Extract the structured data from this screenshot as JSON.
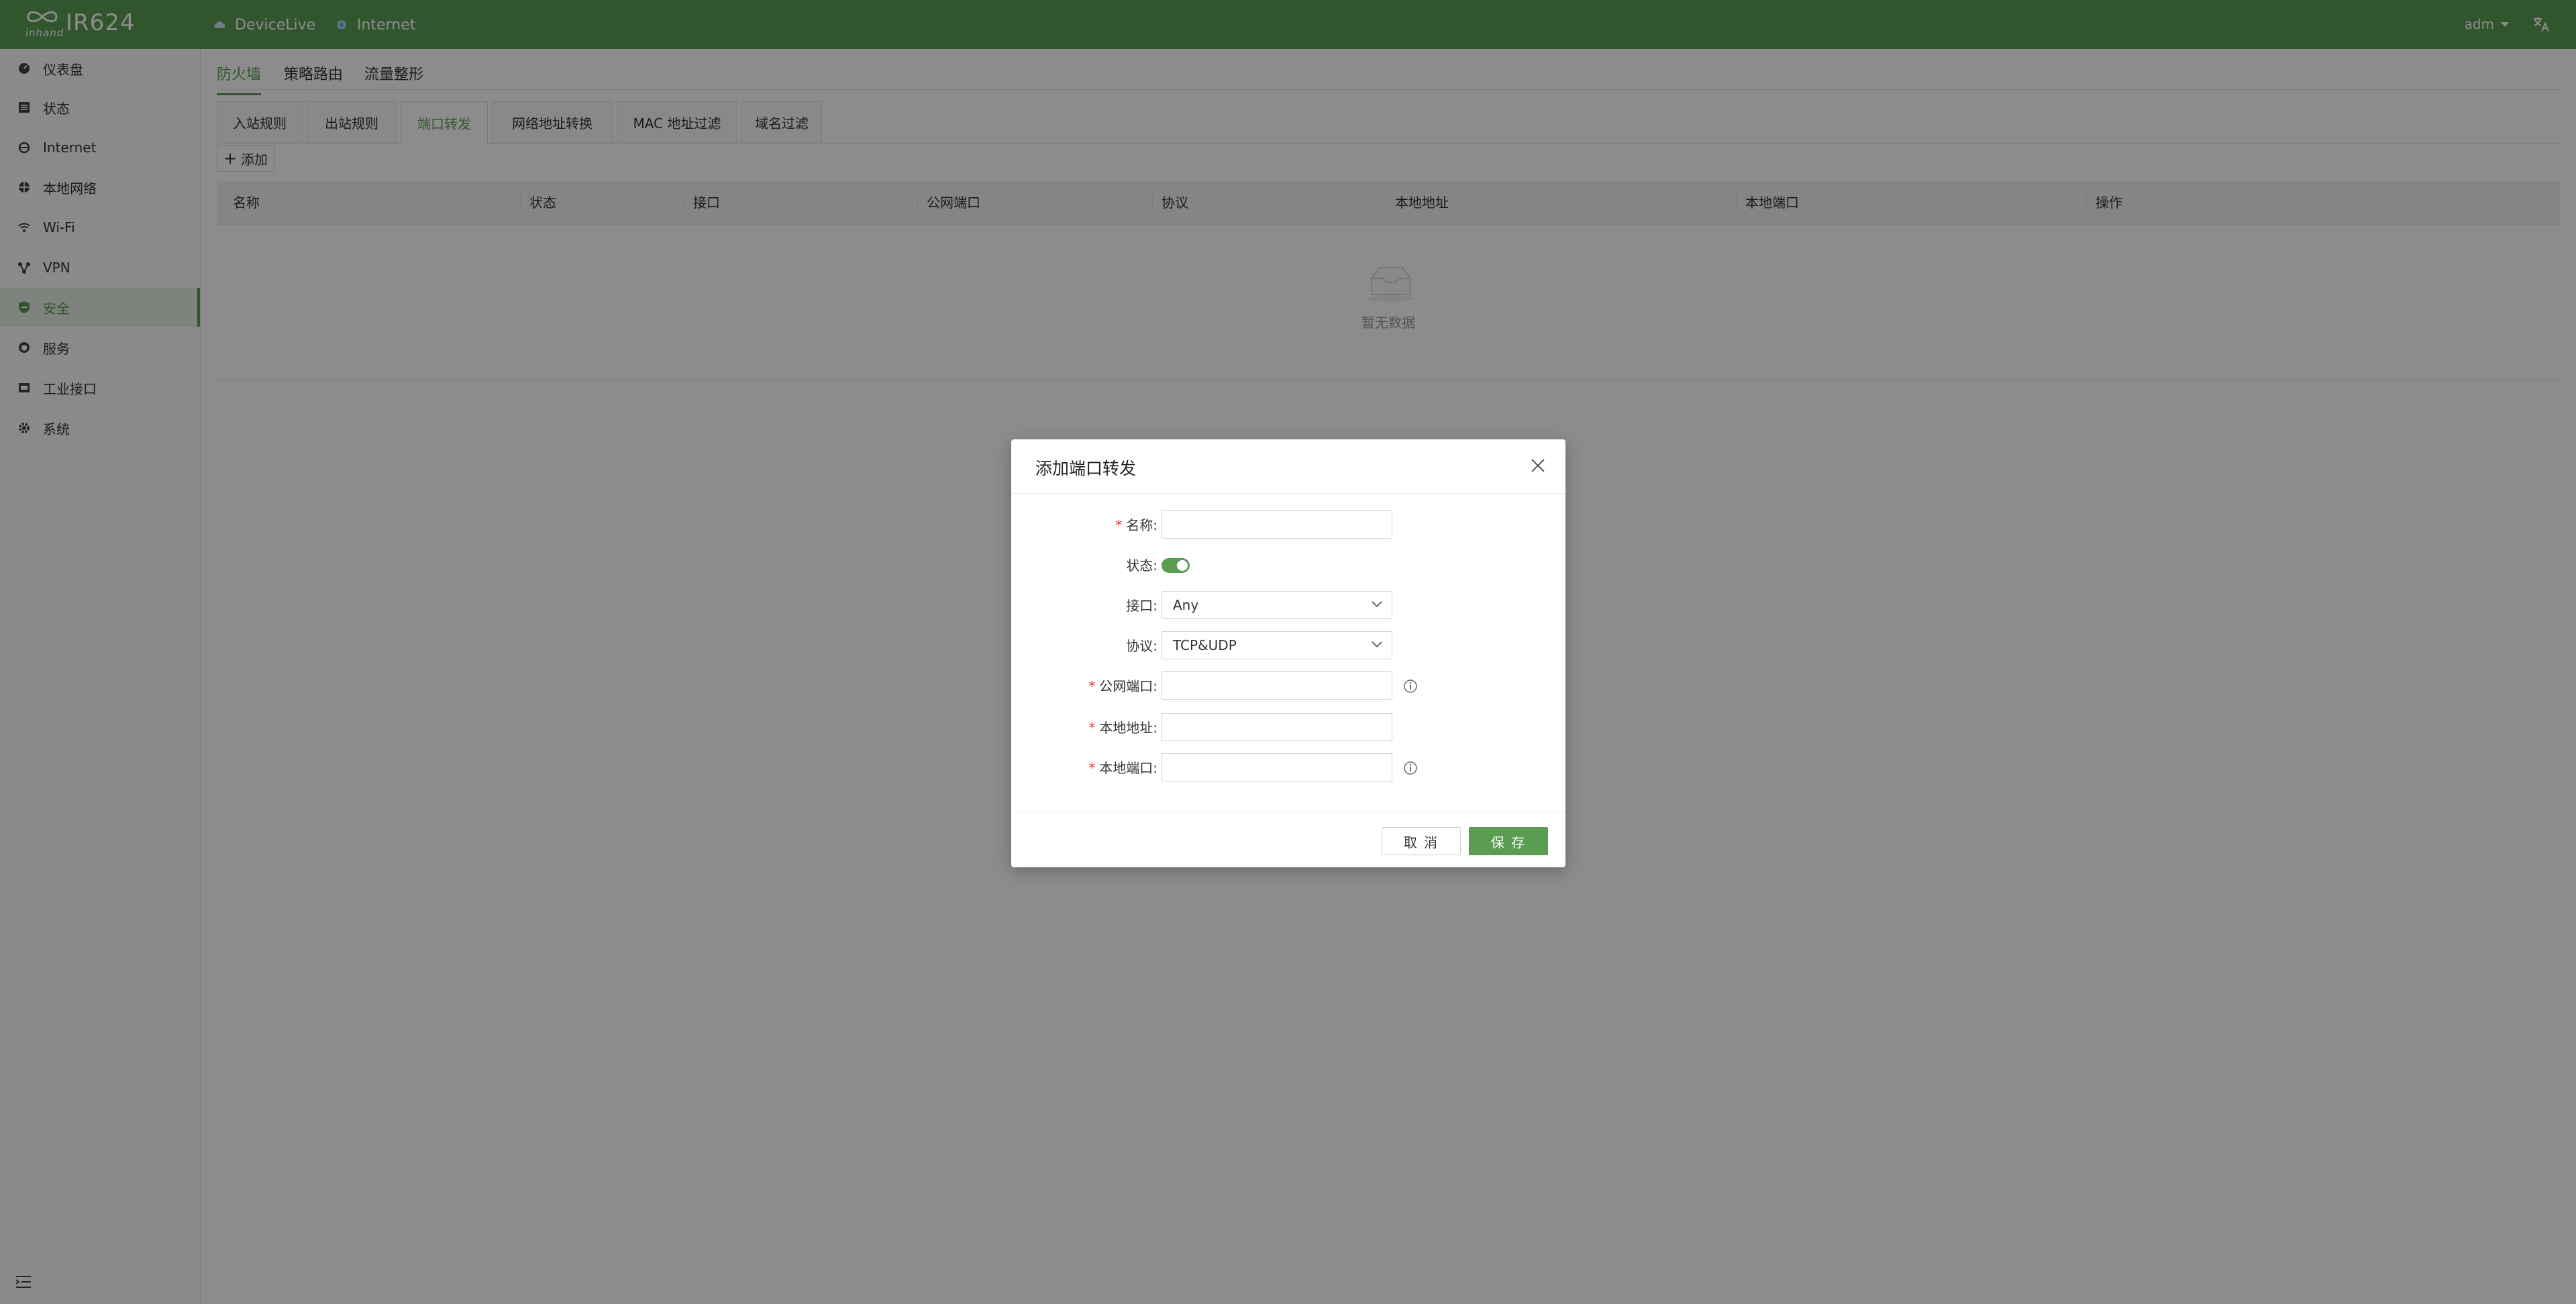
{
  "colors": {
    "brand": "#5a9c52",
    "required": "#e53935"
  },
  "topbar": {
    "brand_text": "inhand",
    "model": "IR624",
    "status_items": [
      {
        "label": "DeviceLive",
        "icon": "cloud-icon"
      },
      {
        "label": "Internet",
        "icon": "globe-status-icon"
      }
    ],
    "user": "adm"
  },
  "sidebar": {
    "items": [
      {
        "label": "仪表盘",
        "icon": "dashboard-icon"
      },
      {
        "label": "状态",
        "icon": "status-list-icon"
      },
      {
        "label": "Internet",
        "icon": "internet-icon"
      },
      {
        "label": "本地网络",
        "icon": "local-network-icon"
      },
      {
        "label": "Wi-Fi",
        "icon": "wifi-icon"
      },
      {
        "label": "VPN",
        "icon": "vpn-icon"
      },
      {
        "label": "安全",
        "icon": "shield-icon",
        "active": true
      },
      {
        "label": "服务",
        "icon": "service-icon"
      },
      {
        "label": "工业接口",
        "icon": "industrial-interface-icon"
      },
      {
        "label": "系统",
        "icon": "gear-icon"
      }
    ]
  },
  "main": {
    "tabs": [
      {
        "label": "防火墙",
        "active": true
      },
      {
        "label": "策略路由"
      },
      {
        "label": "流量整形"
      }
    ],
    "subtabs": [
      {
        "label": "入站规则"
      },
      {
        "label": "出站规则"
      },
      {
        "label": "端口转发",
        "active": true
      },
      {
        "label": "网络地址转换"
      },
      {
        "label": "MAC 地址过滤"
      },
      {
        "label": "域名过滤"
      }
    ],
    "add_label": "添加",
    "table": {
      "columns": [
        "名称",
        "状态",
        "接口",
        "公网端口",
        "协议",
        "本地地址",
        "本地端口",
        "操作"
      ],
      "empty_text": "暂无数据"
    }
  },
  "modal": {
    "title": "添加端口转发",
    "fields": {
      "name": {
        "label": "名称:",
        "value": ""
      },
      "status": {
        "label": "状态:",
        "on": true
      },
      "interface": {
        "label": "接口:",
        "value": "Any"
      },
      "protocol": {
        "label": "协议:",
        "value": "TCP&UDP"
      },
      "public_port": {
        "label": "公网端口:",
        "value": ""
      },
      "local_address": {
        "label": "本地地址:",
        "value": ""
      },
      "local_port": {
        "label": "本地端口:",
        "value": ""
      }
    },
    "required_mark": "*",
    "cancel_label": "取 消",
    "save_label": "保 存"
  }
}
